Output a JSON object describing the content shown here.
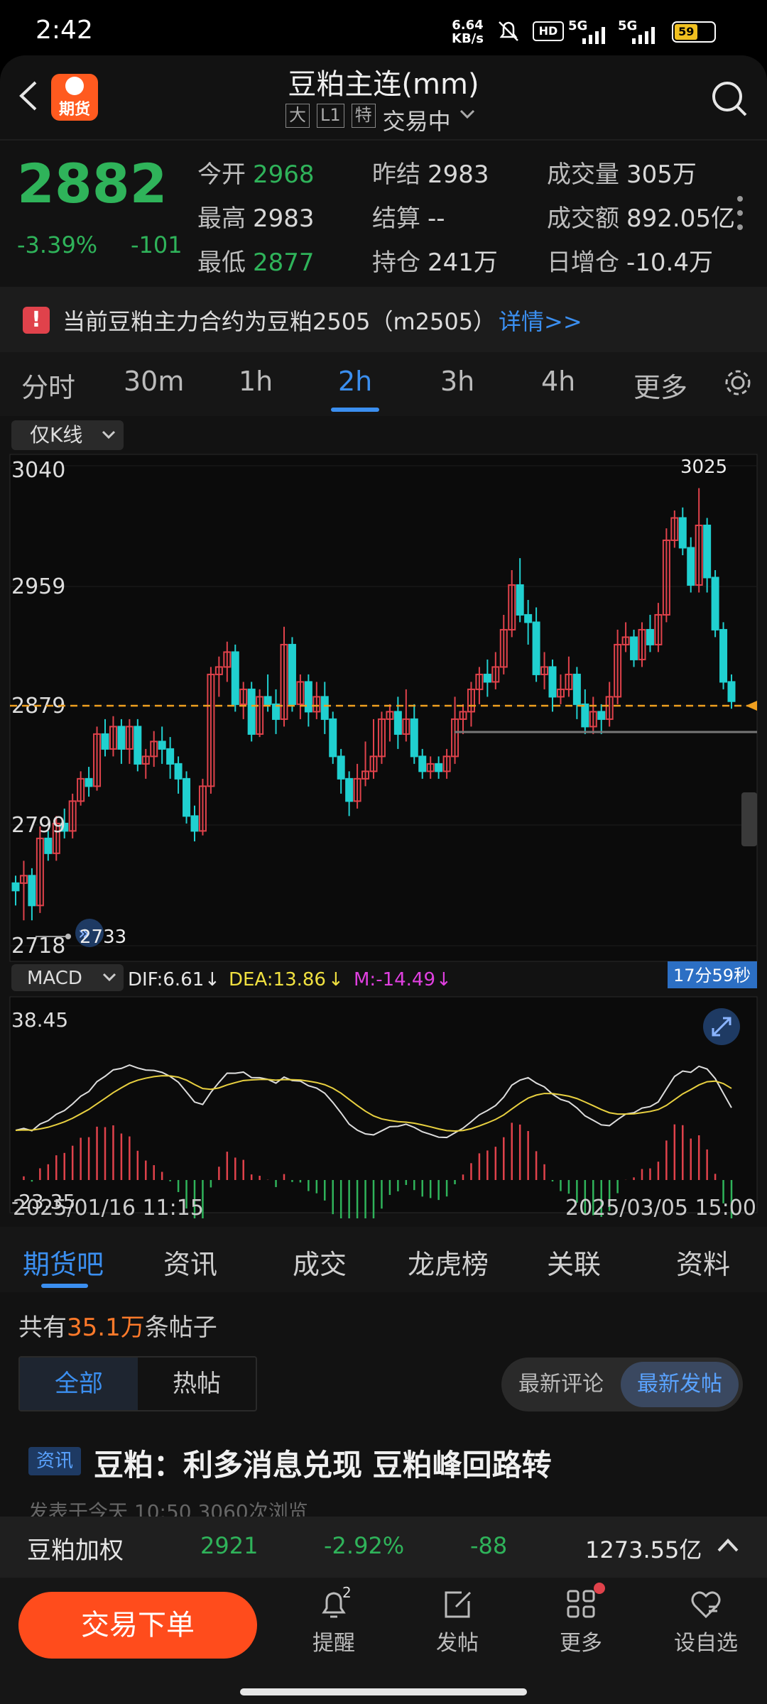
{
  "status_bar": {
    "time": "2:42",
    "speed_value": "6.64",
    "speed_unit": "KB/s",
    "battery": "59",
    "signal1": "5G",
    "signal2": "5G"
  },
  "header": {
    "title": "豆粕主连(mm)",
    "logo_label": "期货",
    "tag1": "大",
    "tag2": "L1",
    "tag3": "特",
    "trading_status": "交易中"
  },
  "quote": {
    "price": "2882",
    "change_pct": "-3.39%",
    "change": "-101",
    "open_label": "今开",
    "open": "2968",
    "high_label": "最高",
    "high": "2983",
    "low_label": "最低",
    "low": "2877",
    "prev_close_label": "昨结",
    "prev_close": "2983",
    "settle_label": "结算",
    "settle": "--",
    "oi_label": "持仓",
    "oi": "241万",
    "volume_label": "成交量",
    "volume": "305万",
    "turnover_label": "成交额",
    "turnover": "892.05亿",
    "daily_inc_label": "日增仓",
    "daily_inc": "-10.4万"
  },
  "notice": {
    "text": "当前豆粕主力合约为豆粕2505（m2505）",
    "link": "详情>>"
  },
  "period_tabs": [
    "分时",
    "30m",
    "1h",
    "2h",
    "3h",
    "4h",
    "更多"
  ],
  "active_period": "2h",
  "kline_selector": "仅K线",
  "macd_selector": "MACD",
  "macd_values": {
    "dif": "DIF:6.61",
    "dea": "DEA:13.86",
    "m": "M:-14.49",
    "arrow": "↓"
  },
  "countdown": "17分59秒",
  "chart_data": {
    "type": "candlestick",
    "y_ticks": [
      "3040",
      "2959",
      "2879",
      "2799",
      "2718"
    ],
    "ylim": [
      2718,
      3040
    ],
    "max_label": "3025",
    "min_label": "2733",
    "current_price_line": 2879,
    "macd_ticks": [
      "38.45",
      "-23.35"
    ],
    "x_start": "2025/01/16 11:15",
    "x_end": "2025/03/05 15:00",
    "candles": [
      [
        2760,
        2755,
        2765,
        2745
      ],
      [
        2760,
        2765,
        2775,
        2735
      ],
      [
        2765,
        2745,
        2770,
        2735
      ],
      [
        2745,
        2790,
        2798,
        2740
      ],
      [
        2790,
        2780,
        2795,
        2775
      ],
      [
        2780,
        2800,
        2805,
        2775
      ],
      [
        2800,
        2795,
        2810,
        2790
      ],
      [
        2795,
        2815,
        2820,
        2790
      ],
      [
        2815,
        2830,
        2835,
        2812
      ],
      [
        2830,
        2825,
        2838,
        2818
      ],
      [
        2825,
        2860,
        2865,
        2822
      ],
      [
        2860,
        2850,
        2870,
        2845
      ],
      [
        2850,
        2865,
        2872,
        2845
      ],
      [
        2865,
        2850,
        2870,
        2840
      ],
      [
        2850,
        2865,
        2870,
        2840
      ],
      [
        2865,
        2840,
        2870,
        2835
      ],
      [
        2840,
        2845,
        2850,
        2830
      ],
      [
        2845,
        2855,
        2862,
        2838
      ],
      [
        2855,
        2850,
        2865,
        2840
      ],
      [
        2850,
        2840,
        2858,
        2830
      ],
      [
        2840,
        2830,
        2845,
        2820
      ],
      [
        2830,
        2805,
        2835,
        2800
      ],
      [
        2805,
        2795,
        2812,
        2788
      ],
      [
        2795,
        2825,
        2830,
        2792
      ],
      [
        2825,
        2900,
        2905,
        2820
      ],
      [
        2900,
        2905,
        2912,
        2885
      ],
      [
        2905,
        2915,
        2922,
        2895
      ],
      [
        2915,
        2880,
        2920,
        2875
      ],
      [
        2880,
        2890,
        2895,
        2870
      ],
      [
        2890,
        2860,
        2895,
        2855
      ],
      [
        2860,
        2885,
        2890,
        2858
      ],
      [
        2885,
        2880,
        2900,
        2875
      ],
      [
        2880,
        2870,
        2890,
        2860
      ],
      [
        2870,
        2920,
        2932,
        2865
      ],
      [
        2920,
        2880,
        2925,
        2875
      ],
      [
        2880,
        2895,
        2900,
        2870
      ],
      [
        2895,
        2875,
        2900,
        2865
      ],
      [
        2875,
        2885,
        2895,
        2870
      ],
      [
        2885,
        2870,
        2895,
        2860
      ],
      [
        2870,
        2845,
        2875,
        2840
      ],
      [
        2845,
        2830,
        2850,
        2820
      ],
      [
        2830,
        2815,
        2835,
        2805
      ],
      [
        2815,
        2830,
        2840,
        2810
      ],
      [
        2830,
        2835,
        2855,
        2825
      ],
      [
        2835,
        2845,
        2870,
        2830
      ],
      [
        2845,
        2870,
        2875,
        2840
      ],
      [
        2870,
        2875,
        2880,
        2855
      ],
      [
        2875,
        2860,
        2885,
        2850
      ],
      [
        2860,
        2870,
        2890,
        2855
      ],
      [
        2870,
        2845,
        2880,
        2840
      ],
      [
        2845,
        2835,
        2850,
        2830
      ],
      [
        2835,
        2840,
        2845,
        2830
      ],
      [
        2840,
        2835,
        2845,
        2830
      ],
      [
        2835,
        2845,
        2850,
        2830
      ],
      [
        2845,
        2870,
        2885,
        2840
      ],
      [
        2870,
        2875,
        2880,
        2860
      ],
      [
        2875,
        2890,
        2895,
        2865
      ],
      [
        2890,
        2900,
        2905,
        2880
      ],
      [
        2900,
        2895,
        2910,
        2885
      ],
      [
        2895,
        2905,
        2915,
        2890
      ],
      [
        2905,
        2930,
        2940,
        2900
      ],
      [
        2930,
        2960,
        2970,
        2925
      ],
      [
        2960,
        2940,
        2978,
        2935
      ],
      [
        2940,
        2935,
        2950,
        2920
      ],
      [
        2935,
        2900,
        2945,
        2895
      ],
      [
        2900,
        2905,
        2915,
        2890
      ],
      [
        2905,
        2885,
        2910,
        2875
      ],
      [
        2885,
        2890,
        2900,
        2880
      ],
      [
        2890,
        2900,
        2912,
        2885
      ],
      [
        2900,
        2880,
        2905,
        2870
      ],
      [
        2880,
        2865,
        2890,
        2860
      ],
      [
        2865,
        2875,
        2885,
        2860
      ],
      [
        2875,
        2870,
        2880,
        2860
      ],
      [
        2870,
        2885,
        2895,
        2865
      ],
      [
        2885,
        2920,
        2930,
        2880
      ],
      [
        2920,
        2925,
        2935,
        2915
      ],
      [
        2925,
        2910,
        2930,
        2905
      ],
      [
        2910,
        2930,
        2935,
        2905
      ],
      [
        2930,
        2920,
        2940,
        2915
      ],
      [
        2920,
        2940,
        2948,
        2915
      ],
      [
        2940,
        2990,
        2998,
        2935
      ],
      [
        2990,
        3005,
        3010,
        2985
      ],
      [
        3005,
        2985,
        3012,
        2980
      ],
      [
        2985,
        2960,
        2992,
        2955
      ],
      [
        2960,
        3000,
        3025,
        2955
      ],
      [
        3000,
        2965,
        3005,
        2955
      ],
      [
        2965,
        2930,
        2970,
        2925
      ],
      [
        2930,
        2895,
        2935,
        2890
      ],
      [
        2895,
        2882,
        2900,
        2877
      ]
    ]
  },
  "content_tabs": [
    "期货吧",
    "资讯",
    "成交",
    "龙虎榜",
    "关联",
    "资料"
  ],
  "posts": {
    "count_prefix": "共有",
    "count_value": "35.1万",
    "count_suffix": "条帖子",
    "filter_all": "全部",
    "filter_hot": "热帖",
    "sort_comment": "最新评论",
    "sort_post": "最新发帖",
    "first_tag": "资讯",
    "first_title": "豆粕：利多消息兑现 豆粕峰回路转",
    "first_meta": "发表于今天 10:50    3060次浏览"
  },
  "ticker": {
    "name": "豆粕加权",
    "price": "2921",
    "pct": "-2.92%",
    "change": "-88",
    "turnover": "1273.55亿"
  },
  "bottom_nav": {
    "trade_button": "交易下单",
    "remind": "提醒",
    "remind_badge": "2",
    "post": "发帖",
    "more": "更多",
    "watchlist": "设自选"
  },
  "colors": {
    "up": "#e0424b",
    "down": "#20d0d0",
    "accent": "#ff5a1f",
    "blue": "#3b8ff0"
  }
}
